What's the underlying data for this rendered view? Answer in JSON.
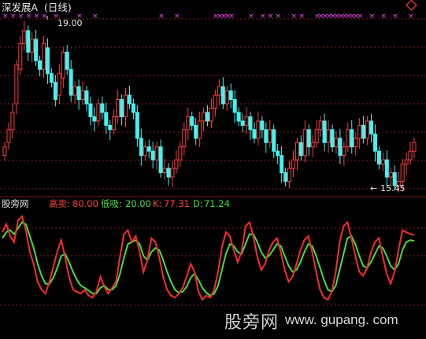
{
  "window": {
    "title": "深发展A",
    "period": "(日线)",
    "colors": {
      "background": "#000000",
      "up_candle": "#ff3b3b",
      "down_candle": "#3ff3f3",
      "signal_marker": "#ff44ff",
      "grid": "#8a1b1b",
      "label_red": "#ff4040",
      "label_green": "#40e040",
      "label_white": "#e0e0e0"
    }
  },
  "price_panel": {
    "high_label": "19.00",
    "low_label": "15.45",
    "low_arrow": "←",
    "top_right_icon": "diamond-icon"
  },
  "indicator_panel": {
    "name": "股旁网",
    "sell_label": "高卖:",
    "sell_value": "80.00",
    "buy_label": "低吸:",
    "buy_value": "20.00",
    "k_label": "K:",
    "k_value": "77.31",
    "d_label": "D:",
    "d_value": "71.24"
  },
  "watermark": {
    "text": "股旁网",
    "url": "www. gupang. com"
  },
  "chart_data": [
    {
      "type": "candlestick",
      "series": [
        {
          "name": "",
          "close": [
            16.2,
            16.6,
            17.0,
            18.1,
            18.6,
            18.9,
            18.4,
            18.7,
            18.2,
            18.0,
            18.6,
            17.9,
            17.7,
            17.3,
            17.9,
            18.4,
            18.0,
            17.4,
            17.6,
            17.3,
            17.5,
            17.2,
            16.9,
            16.8,
            17.2,
            17.0,
            16.7,
            16.6,
            16.9,
            17.3,
            16.9,
            17.4,
            17.2,
            17.0,
            16.4,
            16.0,
            16.2,
            16.1,
            15.9,
            16.2,
            15.6,
            15.7,
            15.5,
            15.7,
            15.9,
            16.2,
            16.6,
            16.9,
            16.7,
            16.4,
            16.8,
            17.0,
            16.8,
            17.1,
            17.4,
            17.6,
            17.2,
            17.5,
            17.3,
            17.0,
            16.8,
            16.7,
            16.9,
            16.6,
            16.4,
            16.8,
            16.6,
            16.3,
            16.6,
            16.1,
            16.0,
            15.6,
            15.4,
            15.7,
            15.9,
            16.3,
            16.0,
            16.6,
            16.2,
            16.3,
            16.6,
            16.8,
            16.3,
            16.6,
            16.2,
            16.4,
            16.0,
            16.2,
            16.6,
            16.2,
            16.4,
            16.7,
            16.4,
            16.8,
            16.5,
            16.1,
            15.8,
            15.9,
            15.5,
            15.6,
            15.3,
            15.4,
            15.8,
            15.9,
            16.1,
            16.3
          ],
          "open": [
            16.0,
            16.3,
            16.6,
            17.2,
            18.0,
            18.6,
            18.9,
            18.4,
            18.7,
            18.2,
            18.0,
            18.5,
            17.9,
            17.7,
            17.4,
            17.8,
            18.4,
            18.0,
            17.4,
            17.6,
            17.3,
            17.5,
            17.2,
            16.9,
            16.8,
            17.2,
            17.0,
            16.7,
            16.6,
            16.9,
            17.3,
            16.9,
            17.4,
            17.2,
            17.0,
            16.4,
            16.0,
            16.2,
            16.1,
            15.9,
            16.2,
            15.6,
            15.7,
            15.5,
            15.7,
            15.9,
            16.2,
            16.6,
            16.9,
            16.7,
            16.4,
            16.8,
            17.0,
            16.8,
            17.1,
            17.4,
            17.6,
            17.2,
            17.5,
            17.3,
            17.0,
            16.8,
            16.7,
            16.9,
            16.6,
            16.4,
            16.8,
            16.6,
            16.3,
            16.6,
            16.1,
            16.0,
            15.6,
            15.4,
            15.7,
            15.9,
            16.3,
            16.0,
            16.6,
            16.2,
            16.3,
            16.6,
            16.8,
            16.3,
            16.6,
            16.2,
            16.4,
            16.0,
            16.2,
            16.6,
            16.2,
            16.4,
            16.7,
            16.4,
            16.8,
            16.5,
            16.1,
            15.8,
            15.9,
            15.5,
            15.6,
            15.3,
            15.4,
            15.8,
            15.9,
            16.1
          ]
        }
      ],
      "annotations": [
        "19.00",
        "15.45"
      ]
    },
    {
      "type": "line",
      "ylim": [
        0,
        100
      ],
      "series": [
        {
          "name": "K",
          "values": [
            80,
            88,
            76,
            70,
            92,
            96,
            82,
            60,
            48,
            30,
            22,
            18,
            30,
            45,
            60,
            72,
            55,
            35,
            22,
            20,
            18,
            22,
            16,
            14,
            20,
            35,
            25,
            18,
            24,
            30,
            55,
            78,
            82,
            70,
            76,
            60,
            40,
            52,
            74,
            70,
            55,
            35,
            22,
            16,
            14,
            18,
            24,
            35,
            48,
            40,
            20,
            12,
            16,
            14,
            22,
            40,
            65,
            80,
            76,
            62,
            50,
            60,
            86,
            90,
            76,
            55,
            42,
            48,
            62,
            70,
            74,
            60,
            42,
            30,
            35,
            48,
            62,
            72,
            76,
            60,
            40,
            22,
            14,
            12,
            20,
            40,
            70,
            86,
            90,
            74,
            56,
            40,
            36,
            44,
            60,
            70,
            74,
            55,
            38,
            28,
            40,
            62,
            82,
            80,
            78,
            77.31
          ]
        },
        {
          "name": "D",
          "values": [
            74,
            80,
            82,
            78,
            84,
            90,
            88,
            76,
            64,
            48,
            36,
            28,
            28,
            34,
            44,
            56,
            58,
            50,
            40,
            32,
            26,
            24,
            21,
            18,
            18,
            24,
            26,
            22,
            22,
            26,
            38,
            54,
            68,
            70,
            72,
            68,
            56,
            52,
            60,
            64,
            62,
            52,
            40,
            30,
            22,
            19,
            20,
            25,
            34,
            38,
            32,
            24,
            19,
            16,
            18,
            26,
            42,
            58,
            68,
            66,
            60,
            58,
            68,
            78,
            78,
            70,
            60,
            54,
            56,
            62,
            68,
            66,
            56,
            46,
            40,
            42,
            50,
            60,
            68,
            66,
            56,
            44,
            32,
            22,
            20,
            26,
            42,
            58,
            74,
            76,
            68,
            56,
            46,
            44,
            50,
            58,
            66,
            64,
            56,
            46,
            42,
            48,
            62,
            70,
            72,
            71.24
          ]
        }
      ]
    }
  ]
}
